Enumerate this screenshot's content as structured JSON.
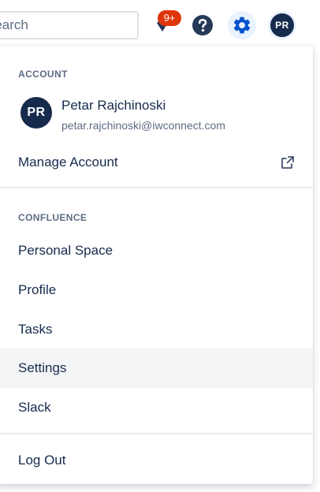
{
  "header": {
    "search_placeholder": "Search",
    "notification_badge": "9+",
    "avatar_initials": "PR",
    "icons": [
      "notification-icon",
      "help-icon",
      "settings-gear-icon"
    ]
  },
  "account_menu": {
    "account_section": {
      "title": "ACCOUNT",
      "user": {
        "initials": "PR",
        "name": "Petar Rajchinoski",
        "email": "petar.rajchinoski@iwconnect.com"
      },
      "manage_account": {
        "label": "Manage Account",
        "icon": "external-link-icon"
      }
    },
    "confluence_section": {
      "title": "CONFLUENCE",
      "items": [
        {
          "label": "Personal Space"
        },
        {
          "label": "Profile"
        },
        {
          "label": "Tasks"
        },
        {
          "label": "Settings",
          "highlighted": true
        },
        {
          "label": "Slack"
        }
      ]
    },
    "logout": {
      "label": "Log Out"
    }
  },
  "colors": {
    "brand_blue": "#0052cc",
    "text_primary": "#172b4d",
    "text_secondary": "#5e6c84",
    "badge_red": "#de350b",
    "avatar_navy": "#172b4d",
    "hover_bg": "#f4f5f7"
  }
}
